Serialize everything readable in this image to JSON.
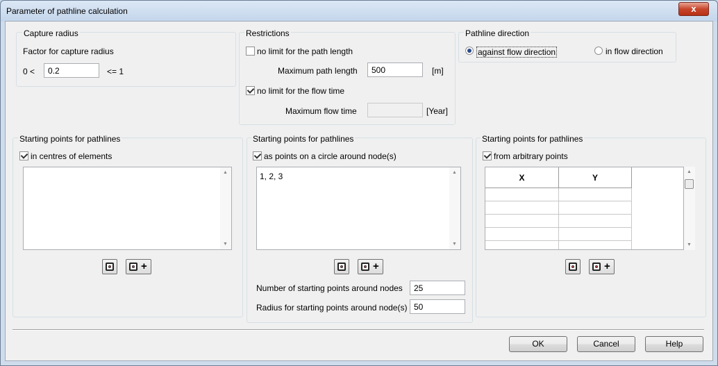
{
  "window": {
    "title": "Parameter of pathline calculation",
    "close_glyph": "x"
  },
  "capture": {
    "group_label": "Capture radius",
    "factor_label": "Factor for capture radius",
    "lower_bound": "0 <",
    "value": "0.2",
    "upper_bound": "<= 1"
  },
  "restrictions": {
    "group_label": "Restrictions",
    "no_limit_length": "no limit for the path length",
    "no_limit_length_checked": false,
    "max_length_label": "Maximum path length",
    "max_length_value": "500",
    "length_unit": "[m]",
    "no_limit_time": "no limit for the flow time",
    "no_limit_time_checked": true,
    "max_time_label": "Maximum flow time",
    "max_time_value": "",
    "time_unit": "[Year]"
  },
  "direction": {
    "group_label": "Pathline direction",
    "against": "against flow direction",
    "in_flow": "in flow direction",
    "selected": "against"
  },
  "start_elements": {
    "group_label": "Starting points for pathlines",
    "checkbox_label": "in centres of elements",
    "checked": true
  },
  "start_nodes": {
    "group_label": "Starting points for pathlines",
    "checkbox_label": "as points on a circle around node(s)",
    "checked": true,
    "list_text": "1, 2, 3",
    "num_points_label": "Number of starting points around nodes",
    "num_points_value": "25",
    "radius_label": "Radius for starting points around node(s)",
    "radius_value": "50"
  },
  "start_arbitrary": {
    "group_label": "Starting points for pathlines",
    "checkbox_label": "from arbitrary points",
    "checked": true,
    "col_x": "X",
    "col_y": "Y"
  },
  "icons": {
    "pick_point": "pick-point-icon",
    "add_point": "add-point-icon"
  },
  "buttons": {
    "ok": "OK",
    "cancel": "Cancel",
    "help": "Help"
  }
}
